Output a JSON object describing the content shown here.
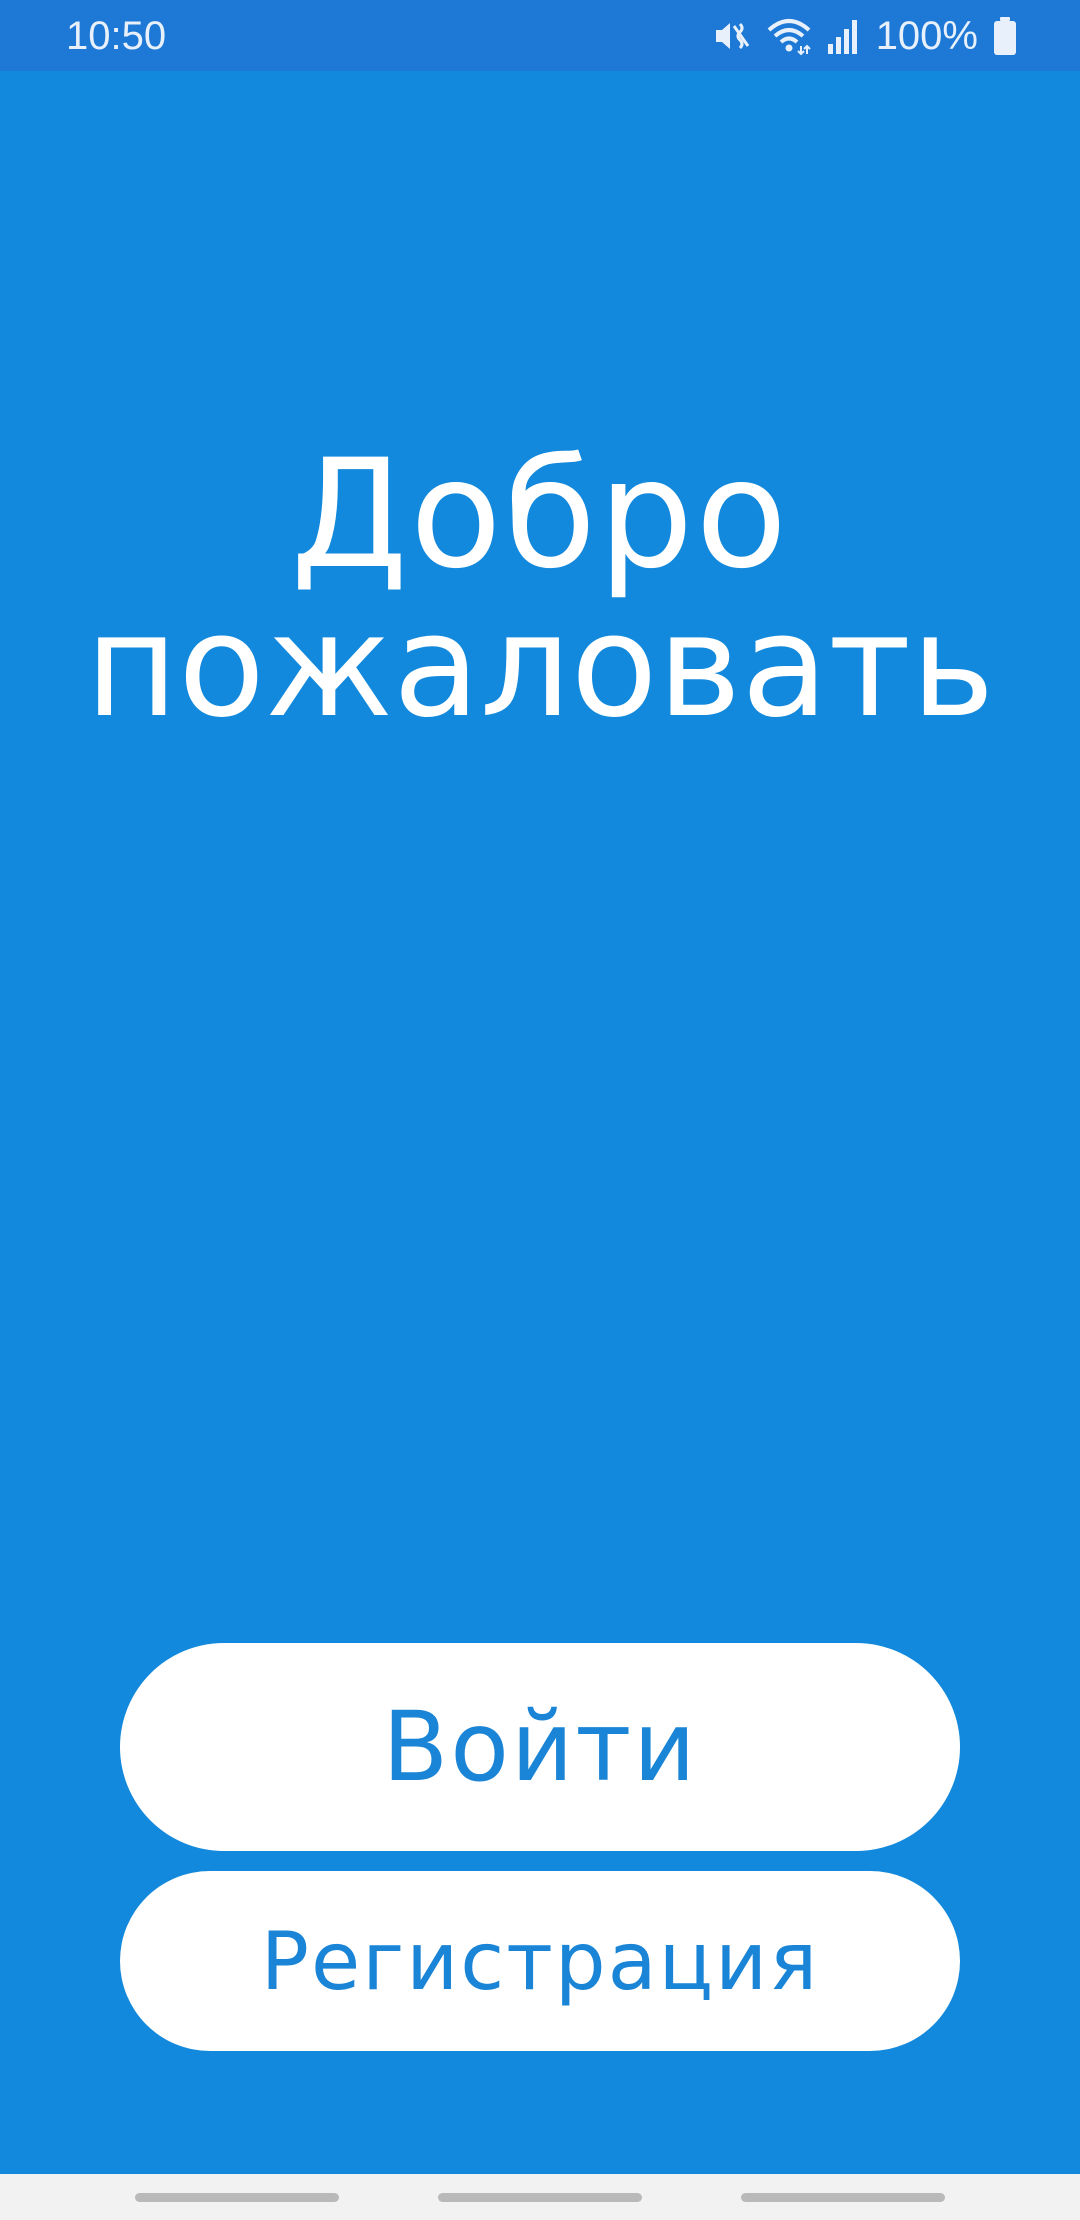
{
  "status_bar": {
    "time": "10:50",
    "battery": "100%",
    "icons": [
      "mute-vibrate-icon",
      "wifi-icon",
      "signal-icon",
      "battery-icon"
    ]
  },
  "welcome": {
    "line1": "Добро",
    "line2": "пожаловать"
  },
  "buttons": {
    "login_label": "Войти",
    "register_label": "Регистрация"
  },
  "colors": {
    "background": "#1289dc",
    "status_bar": "#1e78d6",
    "button_background": "#ffffff",
    "button_text": "#1a84d6",
    "nav_bar": "#f2f2f2"
  },
  "nav_bar": {
    "items": [
      "recents-gesture",
      "home-gesture",
      "back-gesture"
    ]
  }
}
